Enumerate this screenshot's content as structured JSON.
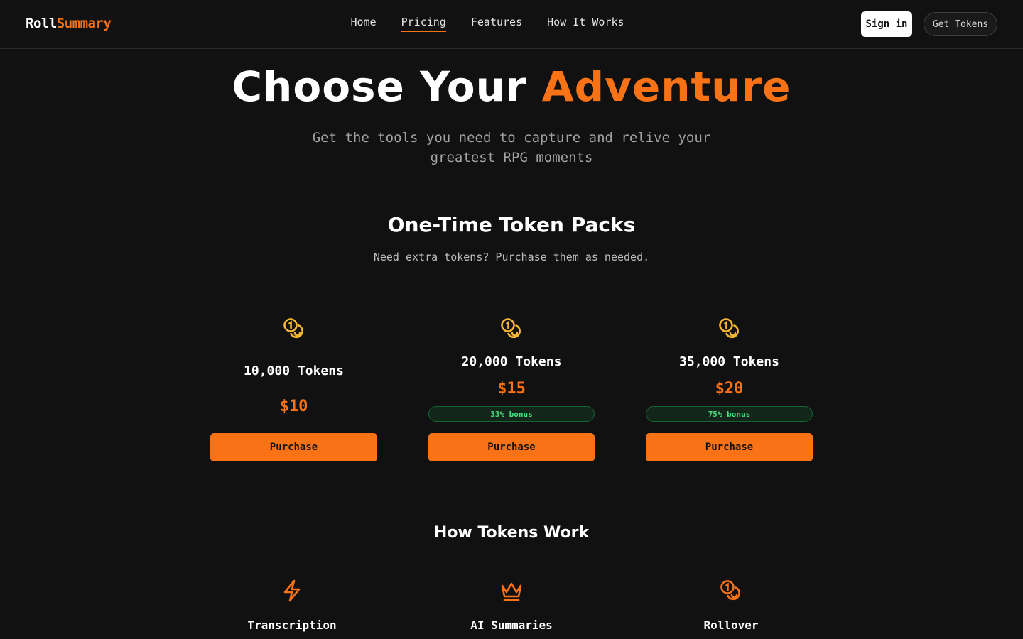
{
  "brand": {
    "part1": "Roll",
    "part2": "Summary"
  },
  "nav": {
    "home": "Home",
    "pricing": "Pricing",
    "features": "Features",
    "how": "How It Works"
  },
  "header_actions": {
    "signin": "Sign in",
    "get_tokens": "Get Tokens"
  },
  "hero": {
    "title_white": "Choose Your ",
    "title_orange": "Adventure",
    "subtitle": "Get the tools you need to capture and relive your greatest RPG moments"
  },
  "packs": {
    "title": "One-Time Token Packs",
    "subtitle": "Need extra tokens? Purchase them as needed.",
    "items": [
      {
        "name": "10,000 Tokens",
        "price": "$10",
        "bonus": "",
        "button": "Purchase"
      },
      {
        "name": "20,000 Tokens",
        "price": "$15",
        "bonus": "33% bonus",
        "button": "Purchase"
      },
      {
        "name": "35,000 Tokens",
        "price": "$20",
        "bonus": "75% bonus",
        "button": "Purchase"
      }
    ]
  },
  "how": {
    "title": "How Tokens Work",
    "items": [
      {
        "label": "Transcription",
        "icon": "lightning-icon"
      },
      {
        "label": "AI Summaries",
        "icon": "crown-icon"
      },
      {
        "label": "Rollover",
        "icon": "coins-icon"
      }
    ]
  },
  "colors": {
    "accent": "#f97316",
    "bonus_text": "#4ade80",
    "background": "#111111",
    "coin_icon": "#f5b731"
  }
}
